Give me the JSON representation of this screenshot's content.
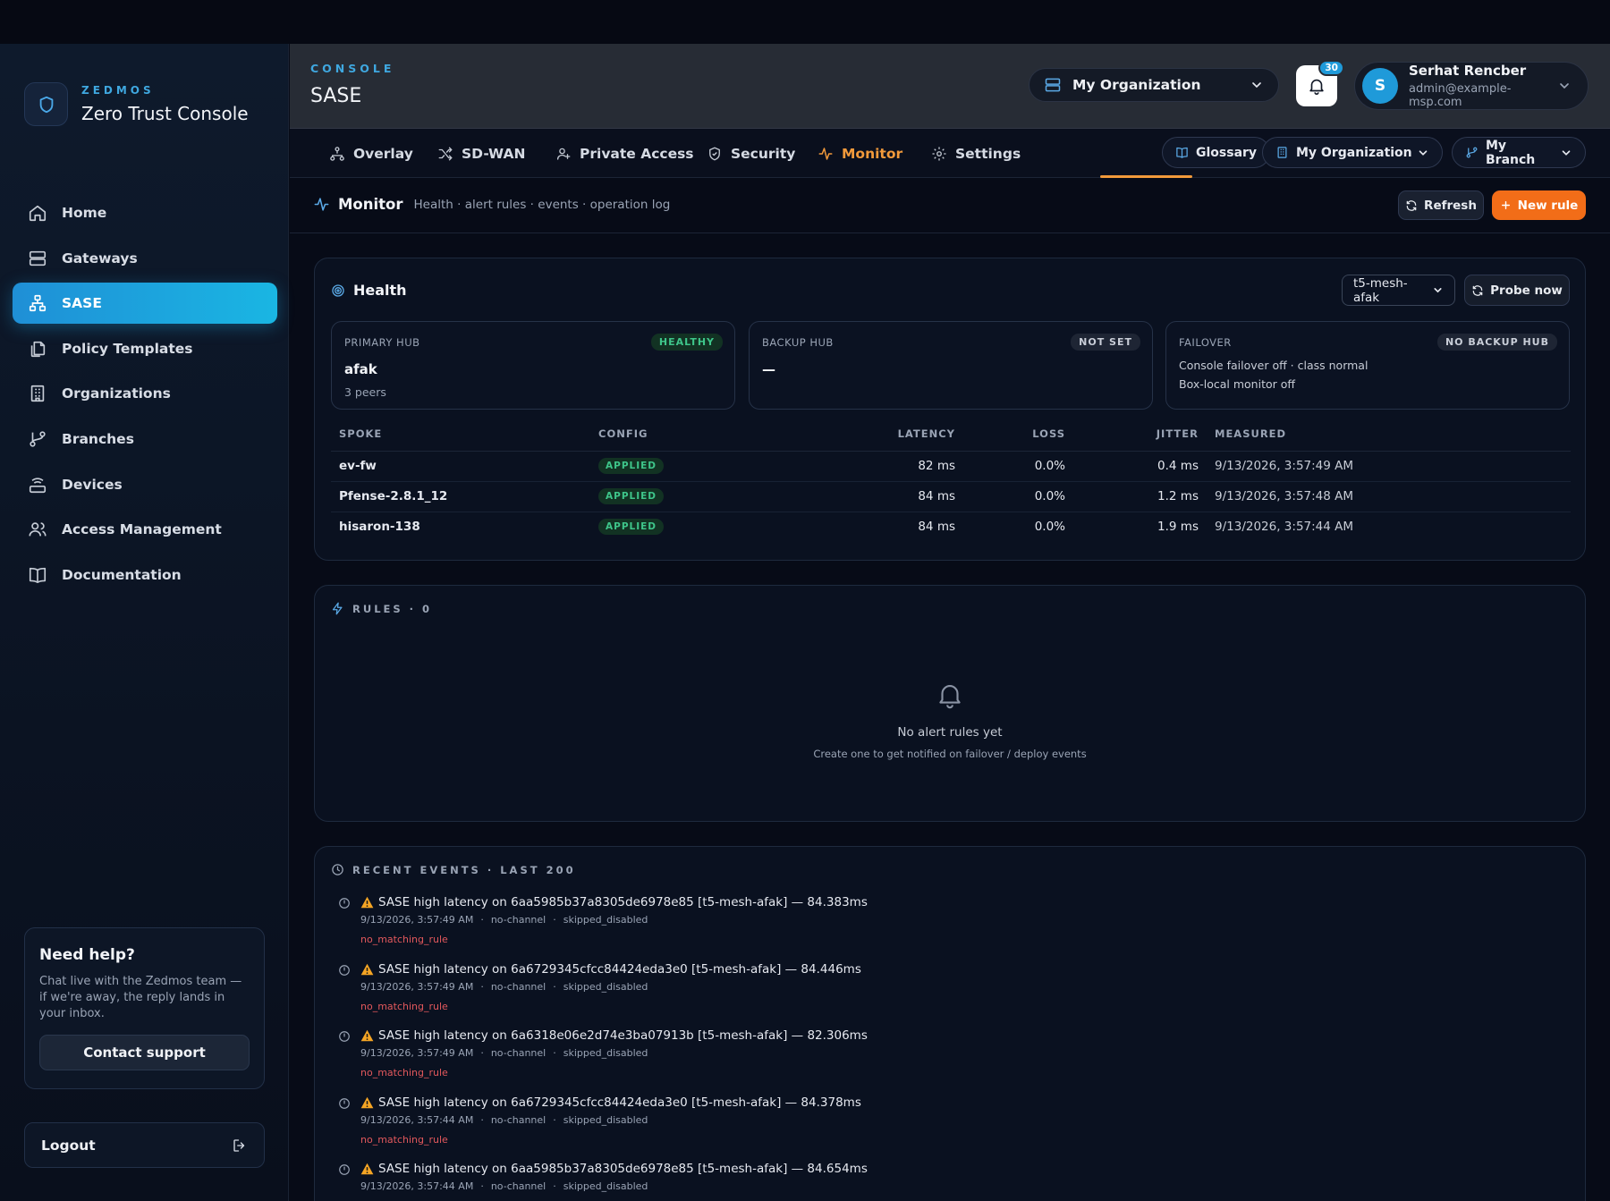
{
  "brand": {
    "kicker": "ZEDMOS",
    "title": "Zero Trust Console"
  },
  "sidebar": {
    "items": [
      {
        "label": "Home",
        "icon": "home-icon"
      },
      {
        "label": "Gateways",
        "icon": "server-icon"
      },
      {
        "label": "SASE",
        "icon": "network-icon",
        "active": true
      },
      {
        "label": "Policy Templates",
        "icon": "copy-icon"
      },
      {
        "label": "Organizations",
        "icon": "building-icon"
      },
      {
        "label": "Branches",
        "icon": "git-branch-icon"
      },
      {
        "label": "Devices",
        "icon": "router-icon"
      },
      {
        "label": "Access Management",
        "icon": "users-icon"
      },
      {
        "label": "Documentation",
        "icon": "book-icon"
      }
    ],
    "help": {
      "title": "Need help?",
      "body": "Chat live with the Zedmos team — if we're away, the reply lands in your inbox.",
      "button": "Contact support"
    },
    "logout": "Logout"
  },
  "header": {
    "kicker": "CONSOLE",
    "title": "SASE",
    "org_select": "My Organization",
    "notifications": "30",
    "user": {
      "initial": "S",
      "name": "Serhat Rencber",
      "email": "admin@example-msp.com"
    }
  },
  "tabs": {
    "items": [
      "Overlay",
      "SD-WAN",
      "Private Access",
      "Security",
      "Monitor",
      "Settings"
    ],
    "active": "Monitor",
    "glossary": "Glossary",
    "org": "My Organization",
    "branch": "My Branch"
  },
  "subheader": {
    "title": "Monitor",
    "description": "Health · alert rules · events · operation log",
    "refresh": "Refresh",
    "new_rule": "New rule"
  },
  "health": {
    "title": "Health",
    "mesh_select": "t5-mesh-afak",
    "probe": "Probe now",
    "primary": {
      "label": "PRIMARY HUB",
      "badge": "HEALTHY",
      "value": "afak",
      "sub": "3 peers"
    },
    "backup": {
      "label": "BACKUP HUB",
      "badge": "NOT SET",
      "value": "—"
    },
    "failover": {
      "label": "FAILOVER",
      "badge": "NO BACKUP HUB",
      "line1": "Console failover off · class normal",
      "line2": "Box-local monitor off"
    },
    "columns": {
      "spoke": "SPOKE",
      "config": "CONFIG",
      "latency": "LATENCY",
      "loss": "LOSS",
      "jitter": "JITTER",
      "measured": "MEASURED"
    },
    "rows": [
      {
        "spoke": "ev-fw",
        "config": "APPLIED",
        "latency": "82 ms",
        "loss": "0.0%",
        "jitter": "0.4 ms",
        "measured": "9/13/2026, 3:57:49 AM"
      },
      {
        "spoke": "Pfense-2.8.1_12",
        "config": "APPLIED",
        "latency": "84 ms",
        "loss": "0.0%",
        "jitter": "1.2 ms",
        "measured": "9/13/2026, 3:57:48 AM"
      },
      {
        "spoke": "hisaron-138",
        "config": "APPLIED",
        "latency": "84 ms",
        "loss": "0.0%",
        "jitter": "1.9 ms",
        "measured": "9/13/2026, 3:57:44 AM"
      }
    ]
  },
  "rules": {
    "title": "RULES · 0",
    "empty_title": "No alert rules yet",
    "empty_sub": "Create one to get notified on failover / deploy events"
  },
  "events": {
    "title": "RECENT EVENTS · LAST 200",
    "items": [
      {
        "text": "SASE high latency on 6aa5985b37a8305de6978e85 [t5-mesh-afak] — 84.383ms",
        "time": "9/13/2026, 3:57:49 AM",
        "channel": "no-channel",
        "status": "skipped_disabled",
        "reason": "no_matching_rule"
      },
      {
        "text": "SASE high latency on 6a6729345cfcc84424eda3e0 [t5-mesh-afak] — 84.446ms",
        "time": "9/13/2026, 3:57:49 AM",
        "channel": "no-channel",
        "status": "skipped_disabled",
        "reason": "no_matching_rule"
      },
      {
        "text": "SASE high latency on 6a6318e06e2d74e3ba07913b [t5-mesh-afak] — 82.306ms",
        "time": "9/13/2026, 3:57:49 AM",
        "channel": "no-channel",
        "status": "skipped_disabled",
        "reason": "no_matching_rule"
      },
      {
        "text": "SASE high latency on 6a6729345cfcc84424eda3e0 [t5-mesh-afak] — 84.378ms",
        "time": "9/13/2026, 3:57:44 AM",
        "channel": "no-channel",
        "status": "skipped_disabled",
        "reason": "no_matching_rule"
      },
      {
        "text": "SASE high latency on 6aa5985b37a8305de6978e85 [t5-mesh-afak] — 84.654ms",
        "time": "9/13/2026, 3:57:44 AM",
        "channel": "no-channel",
        "status": "skipped_disabled",
        "reason": ""
      }
    ]
  },
  "colors": {
    "accent": "#1f9ad9",
    "brand": "#f26d18",
    "active_tab": "#f29a3b",
    "success": "#3ec58a",
    "error": "#e2585c"
  }
}
